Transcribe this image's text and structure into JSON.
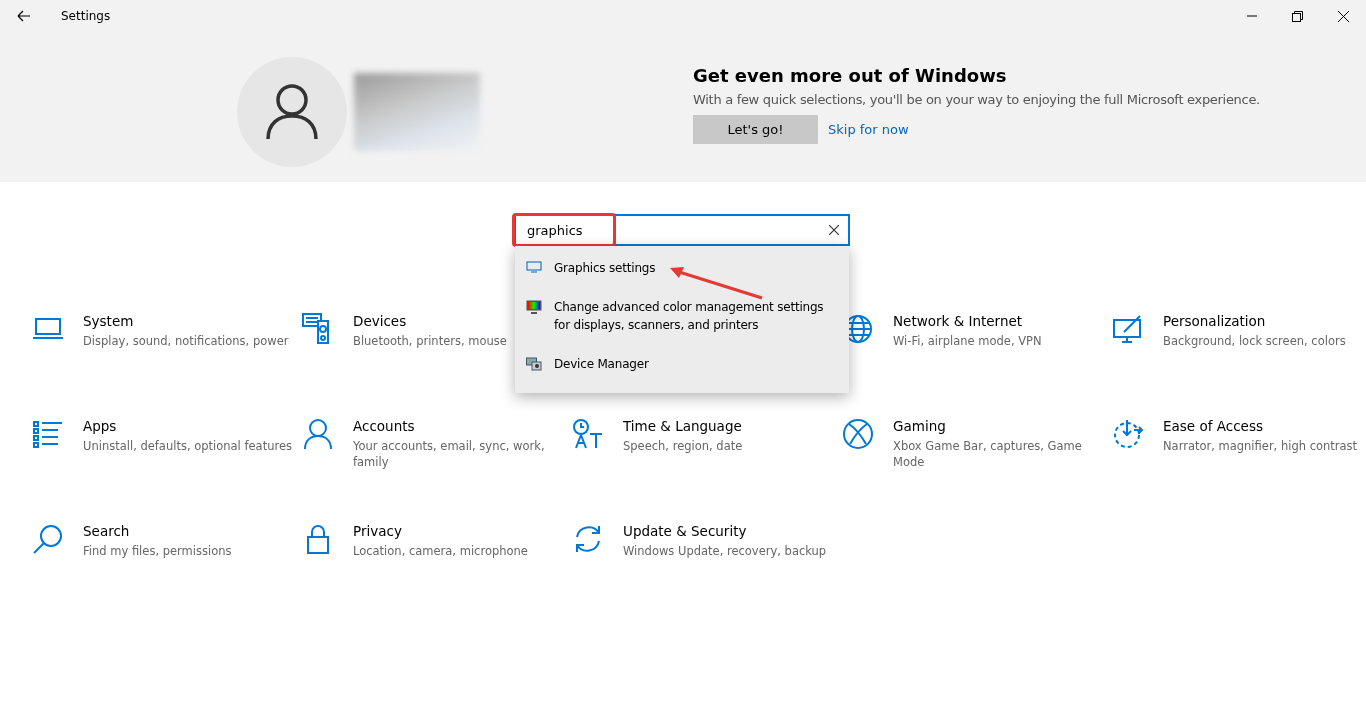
{
  "window": {
    "title": "Settings"
  },
  "banner": {
    "title": "Get even more out of Windows",
    "text": "With a few quick selections, you'll be on your way to enjoying the full Microsoft experience.",
    "primary_button": "Let's go!",
    "link": "Skip for now"
  },
  "search": {
    "value": "graphics",
    "highlighted": true,
    "results": [
      {
        "label": "Graphics settings",
        "pointed": true
      },
      {
        "label": "Change advanced color management settings for displays, scanners, and printers",
        "pointed": false
      },
      {
        "label": "Device Manager",
        "pointed": false
      }
    ]
  },
  "tiles": [
    {
      "title": "System",
      "subtitle": "Display, sound, notifications, power"
    },
    {
      "title": "Devices",
      "subtitle": "Bluetooth, printers, mouse"
    },
    {
      "title": "Network & Internet",
      "subtitle": "Wi-Fi, airplane mode, VPN"
    },
    {
      "title": "Personalization",
      "subtitle": "Background, lock screen, colors"
    },
    {
      "title": "Apps",
      "subtitle": "Uninstall, defaults, optional features"
    },
    {
      "title": "Accounts",
      "subtitle": "Your accounts, email, sync, work, family"
    },
    {
      "title": "Time & Language",
      "subtitle": "Speech, region, date"
    },
    {
      "title": "Gaming",
      "subtitle": "Xbox Game Bar, captures, Game Mode"
    },
    {
      "title": "Ease of Access",
      "subtitle": "Narrator, magnifier, high contrast"
    },
    {
      "title": "Search",
      "subtitle": "Find my files, permissions"
    },
    {
      "title": "Privacy",
      "subtitle": "Location, camera, microphone"
    },
    {
      "title": "Update & Security",
      "subtitle": "Windows Update, recovery, backup"
    }
  ]
}
